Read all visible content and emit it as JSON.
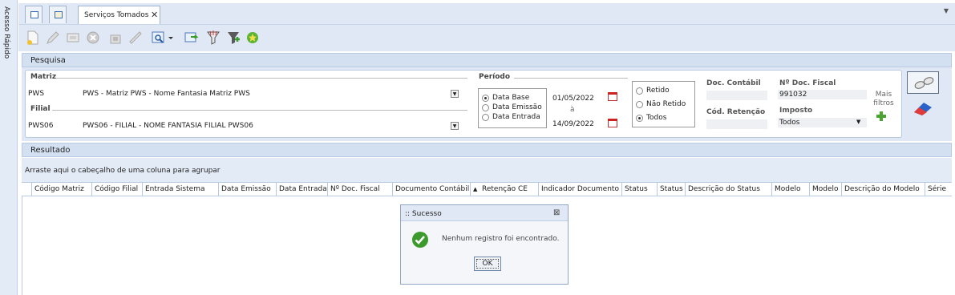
{
  "sidebar": {
    "label": "Acesso Rápido"
  },
  "tabs": {
    "active_label": "Serviços Tomados",
    "close": "✕"
  },
  "pesquisa": {
    "title": "Pesquisa",
    "matriz": {
      "label": "Matriz",
      "code": "PWS",
      "description": "PWS - Matriz PWS - Nome Fantasia Matriz PWS"
    },
    "filial": {
      "label": "Filial",
      "code": "PWS06",
      "description": "PWS06 - FILIAL - NOME FANTASIA FILIAL PWS06"
    },
    "periodo": {
      "label": "Período",
      "options": [
        "Data Base",
        "Data Emissão",
        "Data Entrada"
      ],
      "selected": "Data Base",
      "date_from": "01/05/2022",
      "separator": "à",
      "date_to": "14/09/2022"
    },
    "retencao": {
      "options": [
        "Retido",
        "Não Retido",
        "Todos"
      ],
      "selected": "Todos"
    },
    "doc_contabil": {
      "label": "Doc. Contábil",
      "value": ""
    },
    "cod_retencao": {
      "label": "Cód. Retenção",
      "value": ""
    },
    "doc_fiscal": {
      "label": "Nº Doc. Fiscal",
      "value": "991032"
    },
    "imposto": {
      "label": "Imposto",
      "value": "Todos"
    },
    "mais_filtros": "Mais filtros"
  },
  "resultado": {
    "title": "Resultado",
    "group_hint": "Arraste aqui o cabeçalho de uma coluna para agrupar",
    "columns": [
      "Código Matriz",
      "Código Filial",
      "Entrada Sistema",
      "Data Emissão",
      "Data Entrada",
      "Nº Doc. Fiscal",
      "Documento Contábil",
      "Retenção CE",
      "Indicador Documento",
      "Status",
      "Status",
      "Descrição do Status",
      "Modelo",
      "Modelo",
      "Descrição do Modelo",
      "Série"
    ]
  },
  "dialog": {
    "title": ":: Sucesso",
    "message": "Nenhum registro foi encontrado.",
    "ok": "OK"
  },
  "colors": {
    "accent": "#dfe8f4",
    "success": "#3c9a2c"
  }
}
